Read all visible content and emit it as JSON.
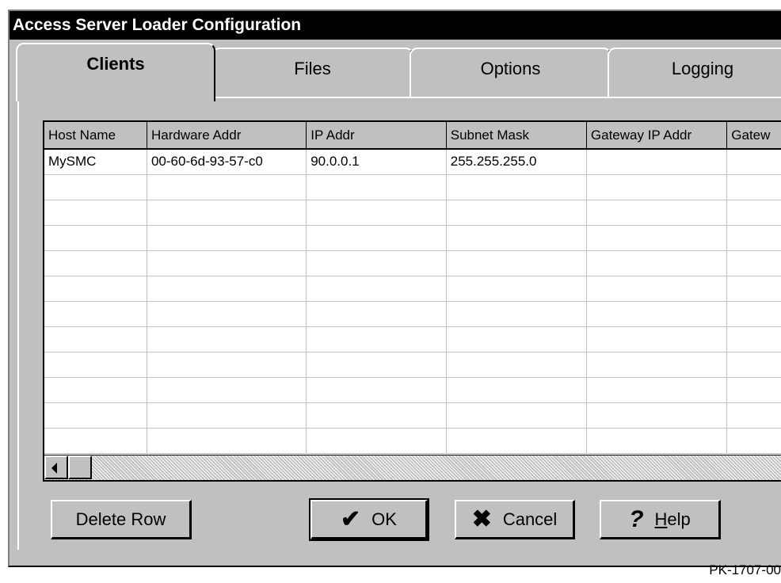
{
  "window": {
    "title": "Access Server Loader Configuration"
  },
  "tabs": [
    {
      "label": "Clients",
      "active": true
    },
    {
      "label": "Files",
      "active": false
    },
    {
      "label": "Options",
      "active": false
    },
    {
      "label": "Logging",
      "active": false
    }
  ],
  "grid": {
    "columns": [
      "Host Name",
      "Hardware Addr",
      "IP Addr",
      "Subnet Mask",
      "Gateway IP Addr",
      "Gatew"
    ],
    "rows": [
      [
        "MySMC",
        "00-60-6d-93-57-c0",
        "90.0.0.1",
        "255.255.255.0",
        "",
        ""
      ],
      [
        "",
        "",
        "",
        "",
        "",
        ""
      ],
      [
        "",
        "",
        "",
        "",
        "",
        ""
      ],
      [
        "",
        "",
        "",
        "",
        "",
        ""
      ],
      [
        "",
        "",
        "",
        "",
        "",
        ""
      ],
      [
        "",
        "",
        "",
        "",
        "",
        ""
      ],
      [
        "",
        "",
        "",
        "",
        "",
        ""
      ],
      [
        "",
        "",
        "",
        "",
        "",
        ""
      ],
      [
        "",
        "",
        "",
        "",
        "",
        ""
      ],
      [
        "",
        "",
        "",
        "",
        "",
        ""
      ],
      [
        "",
        "",
        "",
        "",
        "",
        ""
      ],
      [
        "",
        "",
        "",
        "",
        "",
        ""
      ]
    ]
  },
  "buttons": {
    "delete_row": "Delete Row",
    "ok": "OK",
    "cancel": "Cancel",
    "help_prefix": "H",
    "help_rest": "elp"
  },
  "icons": {
    "ok": "checkmark-icon",
    "cancel": "x-icon",
    "help": "question-icon"
  },
  "figure_id": "PK-1707-00"
}
